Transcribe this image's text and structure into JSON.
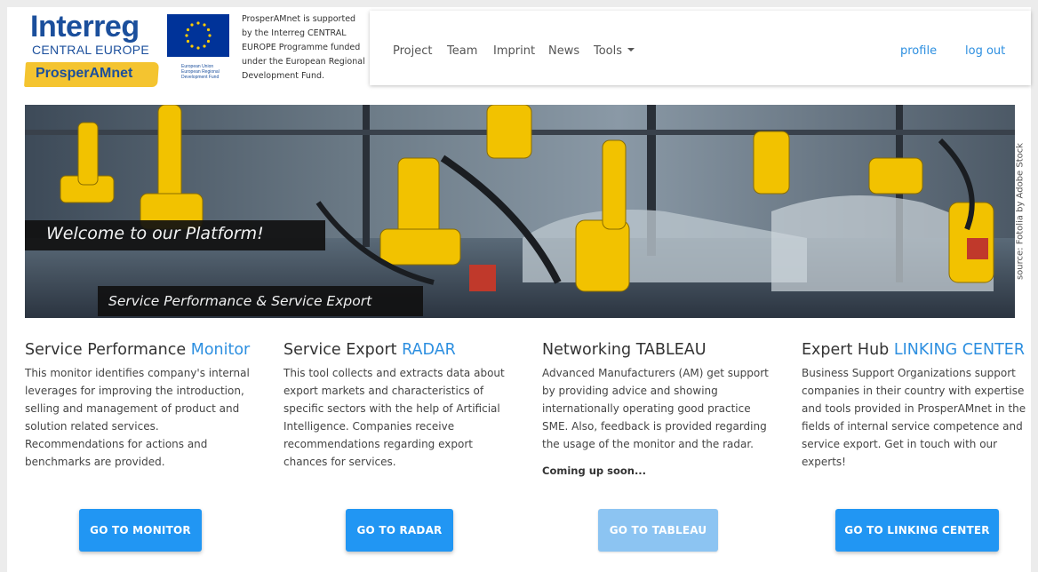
{
  "header": {
    "logo": {
      "brand": "Interreg",
      "subbrand": "CENTRAL EUROPE",
      "project": "ProsperAMnet",
      "eu_note": "European Union European Regional Development Fund"
    },
    "support_text": "ProsperAMnet is supported by the Interreg CENTRAL EUROPE Programme funded under the European Regional Development Fund.",
    "nav": {
      "items": [
        "Project",
        "Team",
        "Imprint",
        "News",
        "Tools"
      ],
      "profile": "profile",
      "logout": "log out"
    }
  },
  "hero": {
    "title": "Welcome to our Platform!",
    "subtitle": "Service Performance & Service Export",
    "credit": "source: Fotolia by Adobe Stock"
  },
  "columns": [
    {
      "title": "Service Performance",
      "title_highlight": "Monitor",
      "text": "This monitor identifies company's internal leverages for improving the introduction, selling and management of product and solution related services. Recommendations for actions and benchmarks are provided.",
      "button": "GO TO MONITOR"
    },
    {
      "title": "Service Export",
      "title_highlight": "RADAR",
      "text": "This tool collects and extracts data about export markets and characteristics of specific sectors with the help of Artificial Intelligence. Companies receive recommendations regarding export chances for services.",
      "button": "GO TO RADAR"
    },
    {
      "title": "Networking TABLEAU",
      "title_highlight": "",
      "text": "Advanced Manufacturers (AM) get support by providing advice and showing internationally operating good practice SME. Also, feedback is provided regarding the usage of the monitor and the radar.",
      "note": "Coming up soon...",
      "button": "GO TO TABLEAU"
    },
    {
      "title": "Expert Hub",
      "title_highlight": "LINKING CENTER",
      "text": "Business Support Organizations support companies in their country with expertise and tools provided in ProsperAMnet in the fields of internal service competence and service export. Get in touch with our experts!",
      "button": "GO TO LINKING CENTER"
    }
  ],
  "colors": {
    "accent": "#2d8fe0",
    "button": "#2196f3",
    "button_disabled": "#8cc4f2",
    "brand_blue": "#1b4f9c",
    "brand_yellow": "#f4c430"
  }
}
